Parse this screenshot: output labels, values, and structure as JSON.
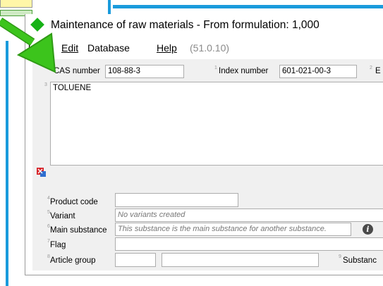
{
  "window": {
    "title": "Maintenance of raw materials - From formulation: 1,000 "
  },
  "menu": {
    "file": "le",
    "edit": "Edit",
    "database": "Database",
    "help": "Help",
    "version": "(51.0.10)"
  },
  "form": {
    "cas_label": "CAS number",
    "cas_value": "108-88-3",
    "index_num": "1",
    "index_label": "Index number",
    "index_value": "601-021-00-3",
    "e_num": "2",
    "e_label": "E",
    "name_num": "3",
    "name_value": "TOLUENE",
    "product_code_num": "4",
    "product_code_label": "Product code",
    "product_code_value": "",
    "variant_num": "5",
    "variant_label": "Variant",
    "variant_placeholder": "No variants created",
    "main_substance_num": "6",
    "main_substance_label": "Main substance",
    "main_substance_placeholder": "This substance is the main substance for another substance.",
    "flag_num": "7",
    "flag_label": "Flag",
    "article_group_num": "8",
    "article_group_label": "Article group",
    "substance_num": "9",
    "substance_label": "Substanc",
    "info_glyph": "i"
  },
  "colors": {
    "accent_blue": "#1a9bdc",
    "arrow_green": "#3cc41c",
    "title_icon": "#17b217"
  }
}
